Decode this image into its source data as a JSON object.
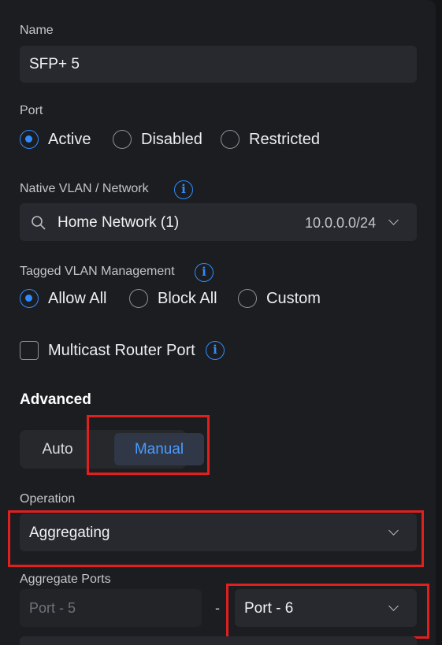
{
  "name_field": {
    "label": "Name",
    "value": "SFP+ 5"
  },
  "port": {
    "label": "Port",
    "options": [
      "Active",
      "Disabled",
      "Restricted"
    ],
    "selected": "Active"
  },
  "native_vlan": {
    "label": "Native VLAN / Network",
    "info_icon": "i",
    "network": "Home Network (1)",
    "subnet": "10.0.0.0/24"
  },
  "tagged_vlan": {
    "label": "Tagged VLAN Management",
    "info_icon": "i",
    "options": [
      "Allow All",
      "Block All",
      "Custom"
    ],
    "selected": "Allow All"
  },
  "multicast": {
    "label": "Multicast Router Port",
    "checked": false,
    "info_icon": "i"
  },
  "advanced": {
    "heading": "Advanced",
    "modes": [
      "Auto",
      "Manual"
    ],
    "selected": "Manual"
  },
  "operation": {
    "label": "Operation",
    "value": "Aggregating"
  },
  "aggregate_ports": {
    "label": "Aggregate Ports",
    "from": "Port - 5",
    "separator": "-",
    "to": "Port - 6"
  },
  "colors": {
    "accent": "#2f8cff",
    "highlight": "#e0201f",
    "panel": "#1c1d20",
    "field": "#27292e"
  }
}
